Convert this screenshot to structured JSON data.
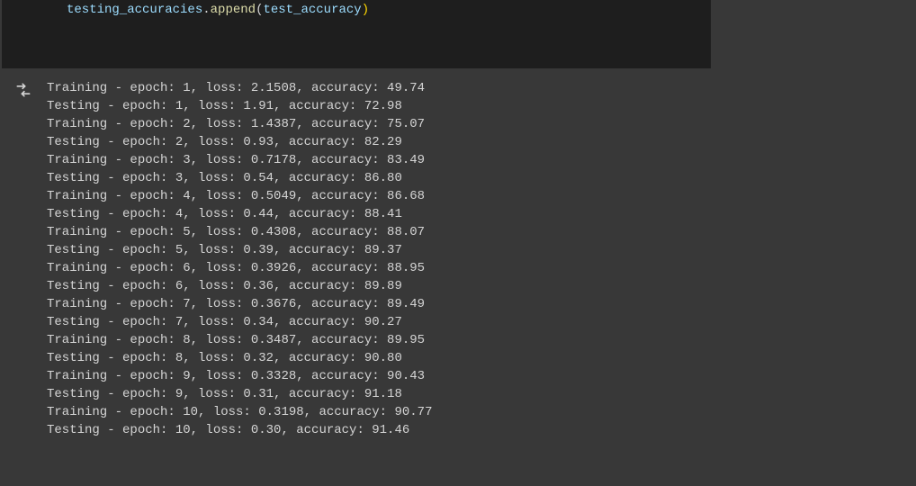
{
  "code": {
    "variable": "testing_accuracies",
    "dot": ".",
    "method": "append",
    "open": "(",
    "param": "test_accuracy",
    "close": ")"
  },
  "output_lines": [
    "Training - epoch: 1, loss: 2.1508, accuracy: 49.74",
    "Testing - epoch: 1, loss: 1.91, accuracy: 72.98",
    "Training - epoch: 2, loss: 1.4387, accuracy: 75.07",
    "Testing - epoch: 2, loss: 0.93, accuracy: 82.29",
    "Training - epoch: 3, loss: 0.7178, accuracy: 83.49",
    "Testing - epoch: 3, loss: 0.54, accuracy: 86.80",
    "Training - epoch: 4, loss: 0.5049, accuracy: 86.68",
    "Testing - epoch: 4, loss: 0.44, accuracy: 88.41",
    "Training - epoch: 5, loss: 0.4308, accuracy: 88.07",
    "Testing - epoch: 5, loss: 0.39, accuracy: 89.37",
    "Training - epoch: 6, loss: 0.3926, accuracy: 88.95",
    "Testing - epoch: 6, loss: 0.36, accuracy: 89.89",
    "Training - epoch: 7, loss: 0.3676, accuracy: 89.49",
    "Testing - epoch: 7, loss: 0.34, accuracy: 90.27",
    "Training - epoch: 8, loss: 0.3487, accuracy: 89.95",
    "Testing - epoch: 8, loss: 0.32, accuracy: 90.80",
    "Training - epoch: 9, loss: 0.3328, accuracy: 90.43",
    "Testing - epoch: 9, loss: 0.31, accuracy: 91.18",
    "Training - epoch: 10, loss: 0.3198, accuracy: 90.77",
    "Testing - epoch: 10, loss: 0.30, accuracy: 91.46"
  ]
}
